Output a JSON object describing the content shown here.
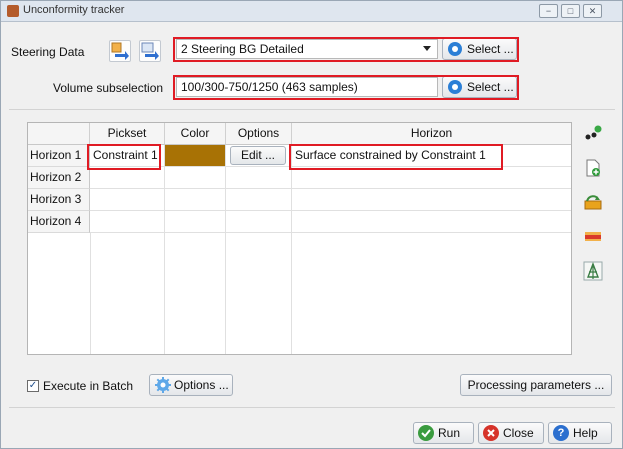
{
  "window": {
    "title": "Unconformity tracker",
    "controls": [
      "minimize-icon",
      "maximize-icon",
      "close-icon"
    ]
  },
  "steering": {
    "label": "Steering Data",
    "selected": "2 Steering BG Detailed",
    "select_label": "Select ..."
  },
  "volume": {
    "label": "Volume subselection",
    "value": "100/300-750/1250 (463 samples)",
    "select_label": "Select ..."
  },
  "table": {
    "columns": [
      "Pickset",
      "Color",
      "Options",
      "Horizon"
    ],
    "rows": [
      {
        "label": "Horizon 1",
        "pickset": "Constraint 1",
        "color": "#a87205",
        "options": "Edit ...",
        "horizon": "Surface constrained by Constraint 1"
      },
      {
        "label": "Horizon 2",
        "pickset": "",
        "color": "",
        "options": "",
        "horizon": ""
      },
      {
        "label": "Horizon 3",
        "pickset": "",
        "color": "",
        "options": "",
        "horizon": ""
      },
      {
        "label": "Horizon 4",
        "pickset": "",
        "color": "",
        "options": "",
        "horizon": ""
      }
    ]
  },
  "side_tools": [
    "dots-icon",
    "new-file-icon",
    "move-up-icon",
    "remove-icon",
    "tree-icon"
  ],
  "batch": {
    "checked": true,
    "label": "Execute in Batch",
    "options_label": "Options ..."
  },
  "processing_label": "Processing parameters ...",
  "footer": {
    "run": "Run",
    "close": "Close",
    "help": "Help"
  },
  "colors": {
    "highlight": "#e01b24",
    "accent": "#2b7fd6",
    "horizon1_color": "#a87205"
  }
}
